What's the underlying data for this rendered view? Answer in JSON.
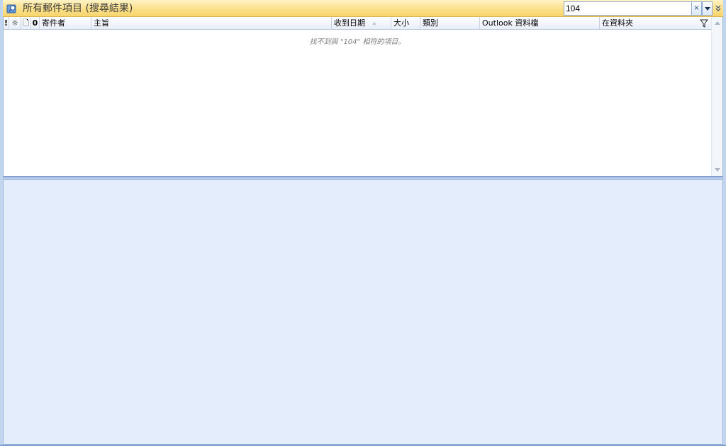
{
  "header": {
    "title": "所有郵件項目 (搜尋結果)",
    "icon": "search-folder-icon"
  },
  "search": {
    "value": "104",
    "clear_label": "×"
  },
  "columns": {
    "importance": "!",
    "reminder": "☼",
    "icon": "🗋",
    "attachment": "0",
    "from": "寄件者",
    "subject": "主旨",
    "received": "收到日期",
    "size": "大小",
    "categories": "類別",
    "data_file": "Outlook 資料檔",
    "in_folder": "在資料夾"
  },
  "list": {
    "empty_message": "找不到與 \"104\" 相符的項目。"
  },
  "colors": {
    "header_gradient_top": "#fff3c6",
    "header_gradient_bottom": "#f8d56c",
    "reading_pane": "#e3edfb",
    "border": "#9fb6d8"
  }
}
